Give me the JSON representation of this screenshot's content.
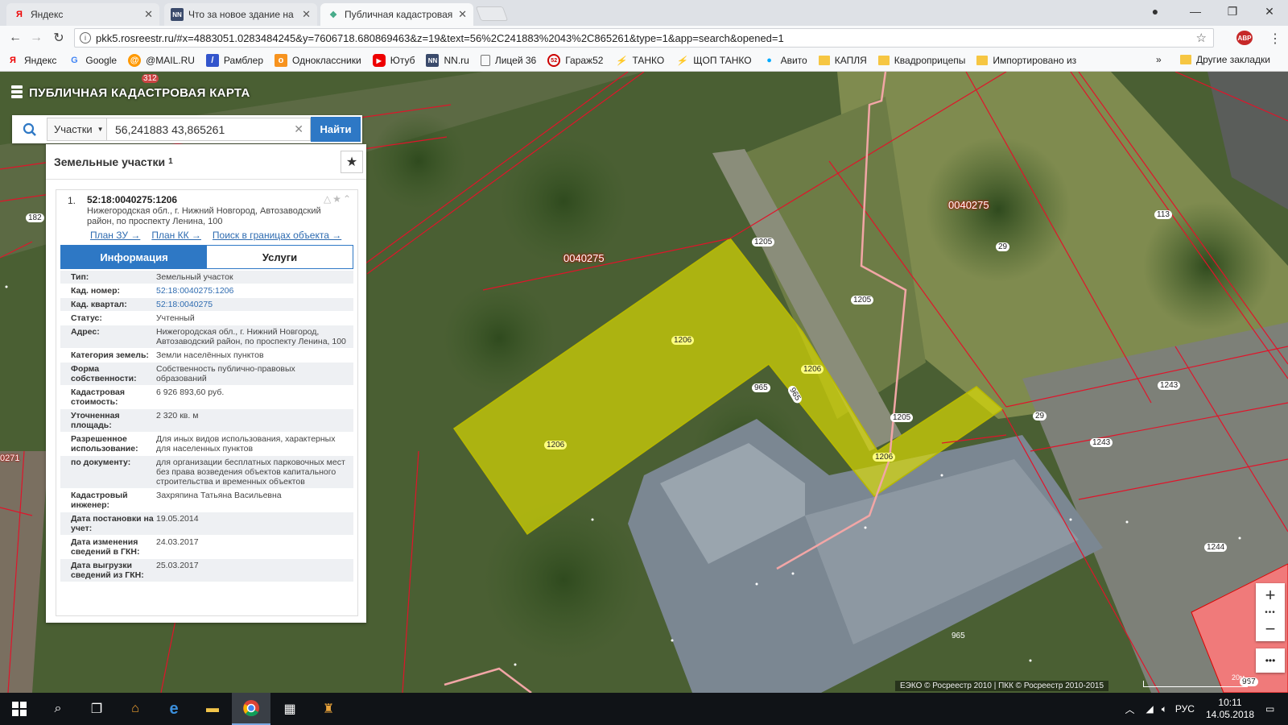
{
  "browser": {
    "tabs": [
      {
        "title": "Яндекс",
        "icon": "yandex-icon"
      },
      {
        "title": "Что за новое здание на",
        "icon": "nn-icon"
      },
      {
        "title": "Публичная кадастровая",
        "icon": "pkk-icon"
      }
    ],
    "url": "pkk5.rosreestr.ru/#x=4883051.0283484245&y=7606718.680869463&z=19&text=56%2C241883%2043%2C865261&type=1&app=search&opened=1",
    "extension_badge": "ABP",
    "bookmarks": [
      "Яндекс",
      "Google",
      "@MAIL.RU",
      "Рамблер",
      "Одноклассники",
      "Ютуб",
      "NN.ru",
      "Лицей 36",
      "Гараж52",
      "ТАНКО",
      "ЩОП ТАНКО",
      "Авито",
      "КАПЛЯ",
      "Квадроприцепы",
      "Импортировано из"
    ],
    "bookmarks_more": "»",
    "other_bookmarks": "Другие закладки"
  },
  "app": {
    "title": "ПУБЛИЧНАЯ КАДАСТРОВАЯ КАРТА",
    "search": {
      "category": "Участки",
      "query": "56,241883 43,865261",
      "button": "Найти"
    }
  },
  "panel": {
    "header": "Земельные участки",
    "count": "1",
    "item": {
      "index": "1.",
      "number": "52:18:0040275:1206",
      "address": "Нижегородская обл., г. Нижний Новгород, Автозаводский район, по проспекту Ленина, 100",
      "links": [
        "План ЗУ →",
        "План КК →",
        "Поиск в границах объекта →"
      ],
      "tabs": {
        "info": "Информация",
        "services": "Услуги"
      },
      "rows": [
        {
          "k": "Тип:",
          "v": "Земельный участок"
        },
        {
          "k": "Кад. номер:",
          "v": "52:18:0040275:1206",
          "link": true
        },
        {
          "k": "Кад. квартал:",
          "v": "52:18:0040275",
          "link": true
        },
        {
          "k": "Статус:",
          "v": "Учтенный"
        },
        {
          "k": "Адрес:",
          "v": "Нижегородская обл., г. Нижний Новгород, Автозаводский район, по проспекту Ленина, 100"
        },
        {
          "k": "Категория земель:",
          "v": "Земли населённых пунктов"
        },
        {
          "k": "Форма собственности:",
          "v": "Собственность публично-правовых образований"
        },
        {
          "k": "Кадастровая стоимость:",
          "v": "6 926 893,60 руб."
        },
        {
          "k": "Уточненная площадь:",
          "v": "2 320 кв. м"
        },
        {
          "k": "Разрешенное использование:",
          "v": "Для иных видов использования, характерных для населенных пунктов"
        },
        {
          "k": "по документу:",
          "v": "для организации бесплатных парковочных мест без права возведения объектов капитального строительства и временных объектов"
        },
        {
          "k": "Кадастровый инженер:",
          "v": "Захряпина Татьяна Васильевна"
        },
        {
          "k": "Дата постановки на учет:",
          "v": "19.05.2014"
        },
        {
          "k": "Дата изменения сведений в ГКН:",
          "v": "24.03.2017"
        },
        {
          "k": "Дата выгрузки сведений из ГКН:",
          "v": "25.03.2017"
        }
      ]
    }
  },
  "map": {
    "labels": [
      "312",
      "182",
      "0271",
      "0040275",
      "0040275",
      "1205",
      "1205",
      "1205",
      "1206",
      "1206",
      "1206",
      "1206",
      "965",
      "965",
      "965",
      "29",
      "29",
      "113",
      "1243",
      "1243",
      "1244",
      "967"
    ],
    "attribution": "ЕЭКО © Росреестр 2010 | ПКК © Росреестр 2010-2015",
    "scale": "20м",
    "highlight_color": "#e0e000",
    "boundary_color": "#e0142a"
  },
  "taskbar": {
    "lang": "РУС",
    "time": "10:11",
    "date": "14.05.2018"
  }
}
